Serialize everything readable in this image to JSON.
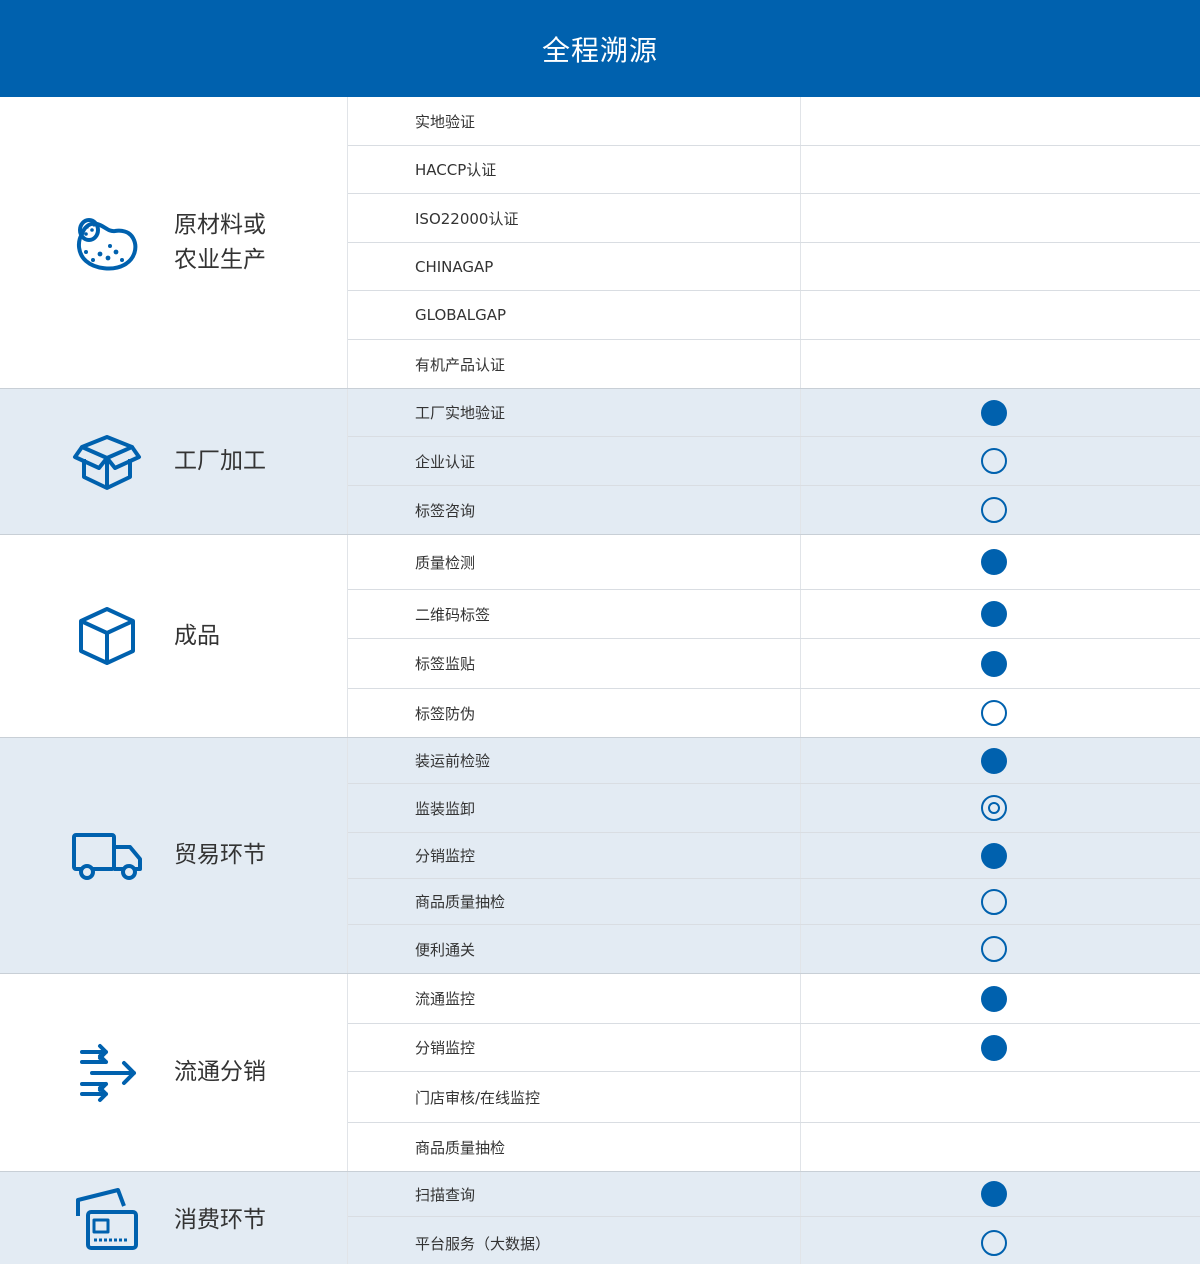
{
  "title": "全程溯源",
  "colors": {
    "brand": "#0061ae",
    "shade": "#e3ebf3"
  },
  "sections": [
    {
      "icon": "potato-icon",
      "label": "原材料或\n农业生产",
      "shaded": false,
      "items": [
        {
          "label": "实地验证",
          "mark": "none"
        },
        {
          "label": "HACCP认证",
          "mark": "none"
        },
        {
          "label": "ISO22000认证",
          "mark": "none"
        },
        {
          "label": "CHINAGAP",
          "mark": "none"
        },
        {
          "label": "GLOBALGAP",
          "mark": "none"
        },
        {
          "label": "有机产品认证",
          "mark": "none"
        }
      ]
    },
    {
      "icon": "open-box-icon",
      "label": "工厂加工",
      "shaded": true,
      "items": [
        {
          "label": "工厂实地验证",
          "mark": "full"
        },
        {
          "label": "企业认证",
          "mark": "empty"
        },
        {
          "label": "标签咨询",
          "mark": "empty"
        }
      ]
    },
    {
      "icon": "closed-box-icon",
      "label": "成品",
      "shaded": false,
      "items": [
        {
          "label": "质量检测",
          "mark": "full"
        },
        {
          "label": "二维码标签",
          "mark": "full"
        },
        {
          "label": "标签监贴",
          "mark": "full"
        },
        {
          "label": "标签防伪",
          "mark": "empty"
        }
      ]
    },
    {
      "icon": "truck-icon",
      "label": "贸易环节",
      "shaded": true,
      "items": [
        {
          "label": "装运前检验",
          "mark": "full"
        },
        {
          "label": "监装监卸",
          "mark": "ring"
        },
        {
          "label": "分销监控",
          "mark": "full"
        },
        {
          "label": "商品质量抽检",
          "mark": "empty"
        },
        {
          "label": "便利通关",
          "mark": "empty"
        }
      ]
    },
    {
      "icon": "flow-arrows-icon",
      "label": "流通分销",
      "shaded": false,
      "items": [
        {
          "label": "流通监控",
          "mark": "full"
        },
        {
          "label": "分销监控",
          "mark": "full"
        },
        {
          "label": "门店审核/在线监控",
          "mark": "none"
        },
        {
          "label": "商品质量抽检",
          "mark": "none"
        }
      ]
    },
    {
      "icon": "cards-icon",
      "label": "消费环节",
      "shaded": true,
      "items": [
        {
          "label": "扫描查询",
          "mark": "full"
        },
        {
          "label": "平台服务（大数据）",
          "mark": "empty"
        }
      ]
    }
  ]
}
